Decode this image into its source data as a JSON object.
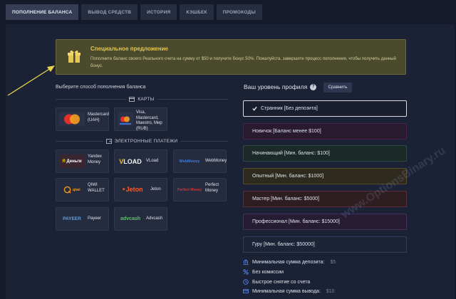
{
  "tabs": [
    {
      "label": "ПОПОЛНЕНИЕ БАЛАНСА",
      "active": true
    },
    {
      "label": "ВЫВОД СРЕДСТВ"
    },
    {
      "label": "ИСТОРИЯ"
    },
    {
      "label": "КЭШБЕК"
    },
    {
      "label": "ПРОМОКОДЫ"
    }
  ],
  "offer": {
    "title": "Специальное предложение",
    "text": "Пополните баланс своего Реального счета на сумму от $50 и получите бонус 50%. Пожалуйста, завершите процесс пополнения, чтобы получить данный бонус."
  },
  "deposit": {
    "title": "Выберите способ пополнения баланса",
    "cards_section": "КАРТЫ",
    "ewallets_section": "ЭЛЕКТРОННЫЕ ПЛАТЕЖИ",
    "cards": [
      {
        "logo": "MasterCard",
        "label": "Mastercard (UAH)"
      },
      {
        "logo": "VISA",
        "label": "Visa, Mastercard, Maestro, Мир (RUB)"
      }
    ],
    "ewallets": [
      {
        "logo": "Яндекс Деньги",
        "label": "Yandex Money"
      },
      {
        "logo": "VLOAD",
        "label": "VLoad"
      },
      {
        "logo": "WebMoney",
        "label": "WebMoney"
      },
      {
        "logo": "QIWI",
        "label": "QIWI WALLET"
      },
      {
        "logo": "Jeton",
        "label": "Jeton"
      },
      {
        "logo": "Perfect Money",
        "label": "Perfect Money"
      },
      {
        "logo": "PAYEER",
        "label": "Payeer"
      },
      {
        "logo": "advcash",
        "label": "Advcash"
      }
    ]
  },
  "profile": {
    "title": "Ваш уровень профиля",
    "compare_label": "Сравнить",
    "levels": [
      {
        "label": "Странник [Без депозита]",
        "selected": true
      },
      {
        "label": "Новичок [Баланс менее $100]"
      },
      {
        "label": "Начинающий [Мин. баланс: $100]"
      },
      {
        "label": "Опытный [Мин. баланс: $1000]"
      },
      {
        "label": "Мастер [Мин. баланс: $5000]"
      },
      {
        "label": "Профессионал [Мин. баланс: $15000]"
      },
      {
        "label": "Гуру [Мин. баланс: $50000]"
      }
    ],
    "level_colors": [
      "#1a1e2e",
      "#2a1a2e",
      "#1b2a26",
      "#2e2a1e",
      "#2e1e22",
      "#261c33",
      "#1c2438"
    ],
    "level_borders": [
      "#d8dbe4",
      "#4a2550",
      "#2c4a3e",
      "#5a4d2c",
      "#5a2e36",
      "#45305e",
      "#2e3c5e"
    ]
  },
  "features": [
    {
      "icon": "bank-icon",
      "label": "Минимальная сумма депозита:",
      "value": "$5"
    },
    {
      "icon": "percent-icon",
      "label": "Без комиссии",
      "value": ""
    },
    {
      "icon": "clock-icon",
      "label": "Быстрое снятие со счета",
      "value": ""
    },
    {
      "icon": "card-icon",
      "label": "Минимальная сумма вывода:",
      "value": "$10"
    }
  ],
  "watermark": "www.OptionsBinary.ru",
  "colors": {
    "accent": "#e3c657",
    "offer_bg": "#4a4a2c",
    "panel": "#1c2236",
    "arrow": "#e8d44a"
  }
}
